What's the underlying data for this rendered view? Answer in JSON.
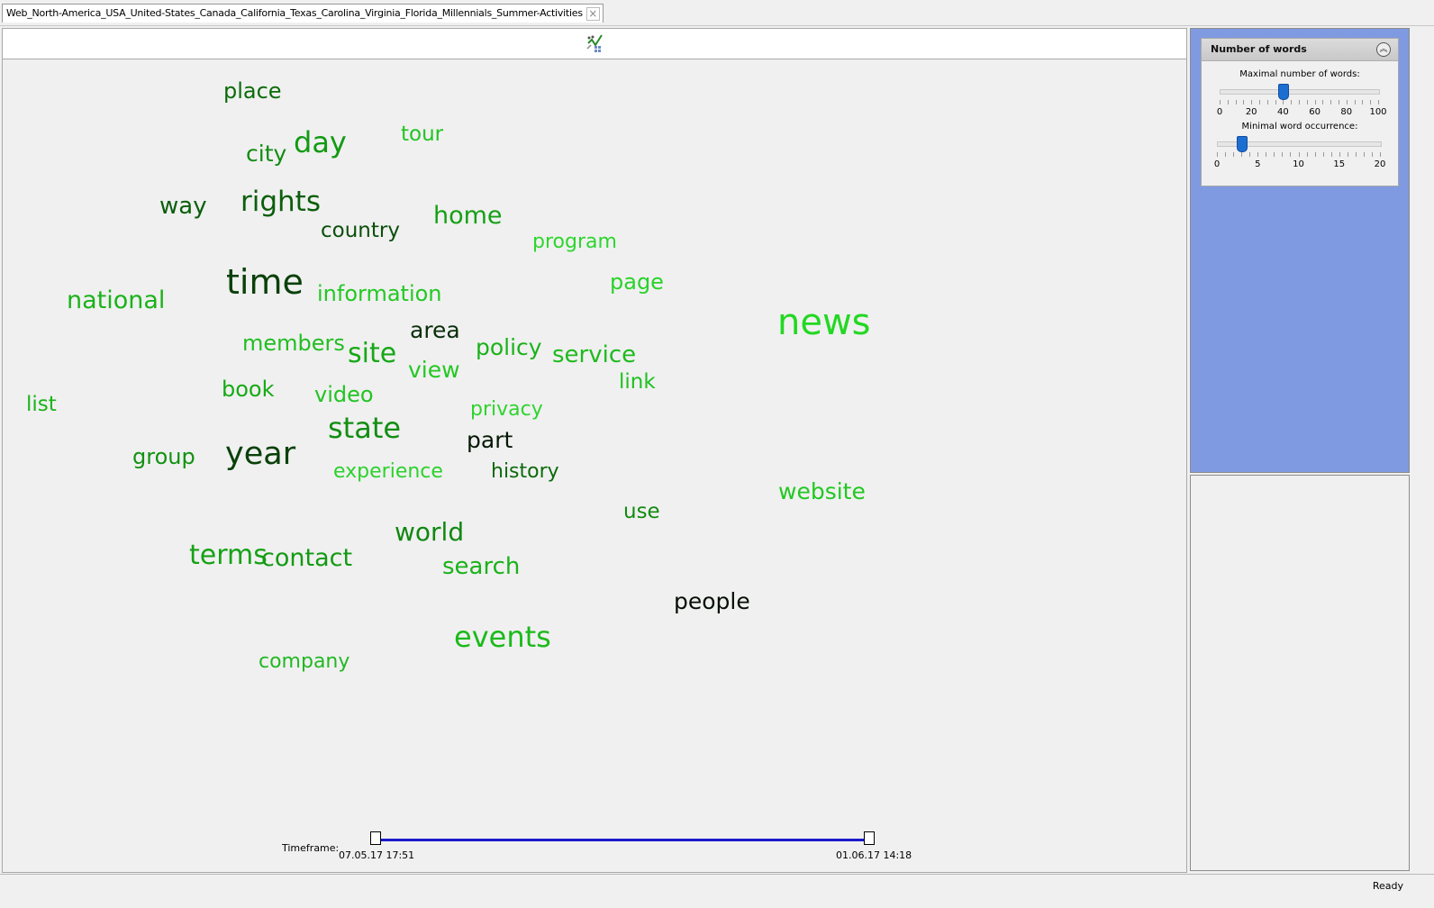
{
  "tab": {
    "label": "Web_North-America_USA_United-States_Canada_California_Texas_Carolina_Virginia_Florida_Millennials_Summer-Activities"
  },
  "toolbar": {
    "icon": "word-cloud-settings-icon"
  },
  "word_cloud": [
    {
      "text": "place",
      "color": "#0a6b0a"
    },
    {
      "text": "day",
      "color": "#129a12"
    },
    {
      "text": "city",
      "color": "#128c12"
    },
    {
      "text": "tour",
      "color": "#22c422"
    },
    {
      "text": "way",
      "color": "#0b5e0b"
    },
    {
      "text": "rights",
      "color": "#0b5e0b"
    },
    {
      "text": "country",
      "color": "#0b4f0b"
    },
    {
      "text": "home",
      "color": "#14a014"
    },
    {
      "text": "program",
      "color": "#2dd62d"
    },
    {
      "text": "time",
      "color": "#0a400a"
    },
    {
      "text": "information",
      "color": "#24c824"
    },
    {
      "text": "national",
      "color": "#1ab21a"
    },
    {
      "text": "page",
      "color": "#2ad22a"
    },
    {
      "text": "news",
      "color": "#22d822"
    },
    {
      "text": "area",
      "color": "#0a2e0a"
    },
    {
      "text": "members",
      "color": "#22be22"
    },
    {
      "text": "site",
      "color": "#16a816"
    },
    {
      "text": "policy",
      "color": "#1ab21a"
    },
    {
      "text": "service",
      "color": "#1eba1e"
    },
    {
      "text": "view",
      "color": "#24c824"
    },
    {
      "text": "link",
      "color": "#20c020"
    },
    {
      "text": "book",
      "color": "#16aa16"
    },
    {
      "text": "video",
      "color": "#22c422"
    },
    {
      "text": "list",
      "color": "#1ab41a"
    },
    {
      "text": "privacy",
      "color": "#2ed42e"
    },
    {
      "text": "state",
      "color": "#138e13"
    },
    {
      "text": "part",
      "color": "#061806"
    },
    {
      "text": "group",
      "color": "#129212"
    },
    {
      "text": "year",
      "color": "#0a400a"
    },
    {
      "text": "experience",
      "color": "#2cd22c"
    },
    {
      "text": "history",
      "color": "#0c6a0c"
    },
    {
      "text": "website",
      "color": "#22c822"
    },
    {
      "text": "use",
      "color": "#118c11"
    },
    {
      "text": "world",
      "color": "#108810"
    },
    {
      "text": "terms",
      "color": "#16a216"
    },
    {
      "text": "contact",
      "color": "#139a13"
    },
    {
      "text": "search",
      "color": "#1ab21a"
    },
    {
      "text": "people",
      "color": "#050f05"
    },
    {
      "text": "events",
      "color": "#1bba1b"
    },
    {
      "text": "company",
      "color": "#22b822"
    }
  ],
  "timeframe": {
    "label": "Timeframe:",
    "start": "07.05.17 17:51",
    "end": "01.06.17 14:18"
  },
  "side_panel": {
    "title": "Number of words",
    "collapse_icon": "chevron-up-icon",
    "max_words": {
      "label": "Maximal number of words:",
      "value": 40,
      "min": 0,
      "max": 100,
      "ticks": [
        "0",
        "20",
        "40",
        "60",
        "80",
        "100"
      ]
    },
    "min_occurrence": {
      "label": "Minimal word occurrence:",
      "value": 3,
      "min": 0,
      "max": 20,
      "ticks": [
        "0",
        "5",
        "10",
        "15",
        "20"
      ]
    }
  },
  "status": {
    "text": "Ready"
  }
}
